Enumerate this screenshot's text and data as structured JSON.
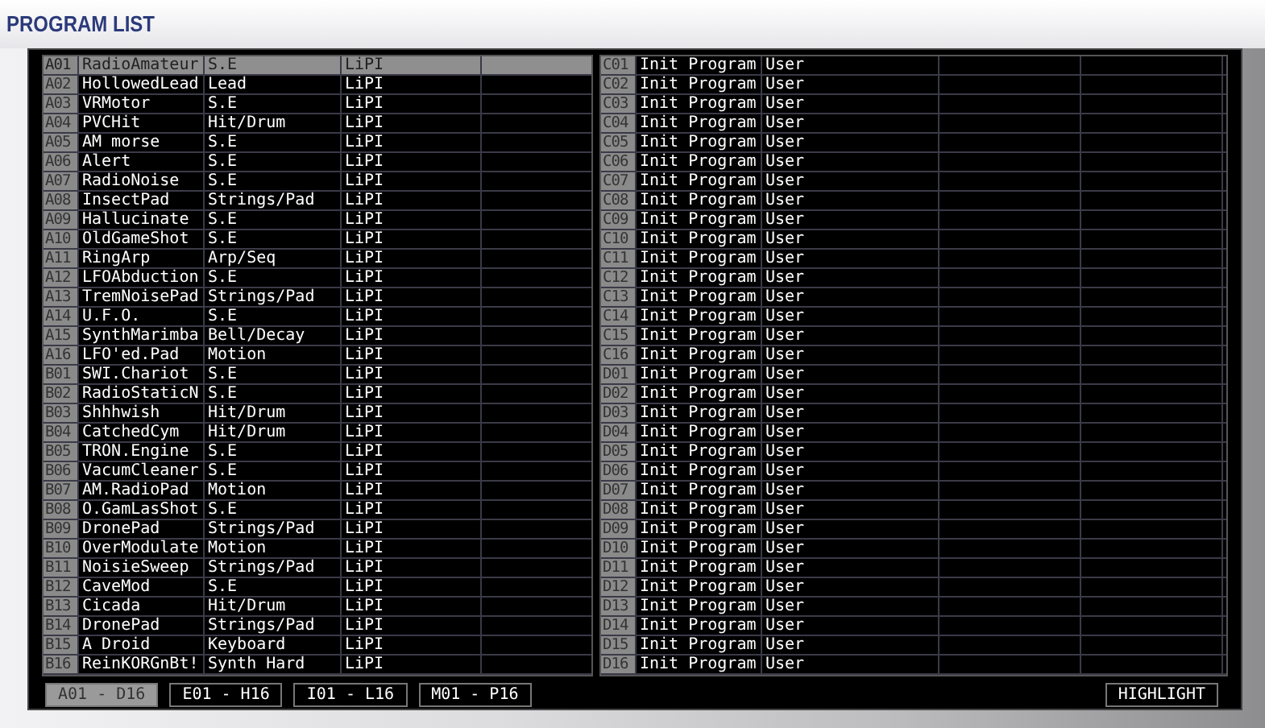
{
  "title": "PROGRAM LIST",
  "tables": [
    {
      "kind": "left",
      "rows": [
        {
          "id": "A01",
          "name": "RadioAmateur",
          "category": "S.E",
          "bank": "LiPI",
          "selected": true
        },
        {
          "id": "A02",
          "name": "HollowedLead",
          "category": "Lead",
          "bank": "LiPI",
          "selected": false
        },
        {
          "id": "A03",
          "name": "VRMotor",
          "category": "S.E",
          "bank": "LiPI",
          "selected": false
        },
        {
          "id": "A04",
          "name": "PVCHit",
          "category": "Hit/Drum",
          "bank": "LiPI",
          "selected": false
        },
        {
          "id": "A05",
          "name": "AM morse",
          "category": "S.E",
          "bank": "LiPI",
          "selected": false
        },
        {
          "id": "A06",
          "name": "Alert",
          "category": "S.E",
          "bank": "LiPI",
          "selected": false
        },
        {
          "id": "A07",
          "name": "RadioNoise",
          "category": "S.E",
          "bank": "LiPI",
          "selected": false
        },
        {
          "id": "A08",
          "name": "InsectPad",
          "category": "Strings/Pad",
          "bank": "LiPI",
          "selected": false
        },
        {
          "id": "A09",
          "name": "Hallucinate",
          "category": "S.E",
          "bank": "LiPI",
          "selected": false
        },
        {
          "id": "A10",
          "name": "OldGameShot",
          "category": "S.E",
          "bank": "LiPI",
          "selected": false
        },
        {
          "id": "A11",
          "name": "RingArp",
          "category": "Arp/Seq",
          "bank": "LiPI",
          "selected": false
        },
        {
          "id": "A12",
          "name": "LFOAbduction",
          "category": "S.E",
          "bank": "LiPI",
          "selected": false
        },
        {
          "id": "A13",
          "name": "TremNoisePad",
          "category": "Strings/Pad",
          "bank": "LiPI",
          "selected": false
        },
        {
          "id": "A14",
          "name": "U.F.O.",
          "category": "S.E",
          "bank": "LiPI",
          "selected": false
        },
        {
          "id": "A15",
          "name": "SynthMarimba",
          "category": "Bell/Decay",
          "bank": "LiPI",
          "selected": false
        },
        {
          "id": "A16",
          "name": "LFO'ed.Pad",
          "category": "Motion",
          "bank": "LiPI",
          "selected": false
        },
        {
          "id": "B01",
          "name": "SWI.Chariot",
          "category": "S.E",
          "bank": "LiPI",
          "selected": false
        },
        {
          "id": "B02",
          "name": "RadioStaticN",
          "category": "S.E",
          "bank": "LiPI",
          "selected": false
        },
        {
          "id": "B03",
          "name": "Shhhwish",
          "category": "Hit/Drum",
          "bank": "LiPI",
          "selected": false
        },
        {
          "id": "B04",
          "name": "CatchedCym",
          "category": "Hit/Drum",
          "bank": "LiPI",
          "selected": false
        },
        {
          "id": "B05",
          "name": "TRON.Engine",
          "category": "S.E",
          "bank": "LiPI",
          "selected": false
        },
        {
          "id": "B06",
          "name": "VacumCleaner",
          "category": "S.E",
          "bank": "LiPI",
          "selected": false
        },
        {
          "id": "B07",
          "name": "AM.RadioPad",
          "category": "Motion",
          "bank": "LiPI",
          "selected": false
        },
        {
          "id": "B08",
          "name": "O.GamLasShot",
          "category": "S.E",
          "bank": "LiPI",
          "selected": false
        },
        {
          "id": "B09",
          "name": "DronePad",
          "category": "Strings/Pad",
          "bank": "LiPI",
          "selected": false
        },
        {
          "id": "B10",
          "name": "OverModulate",
          "category": "Motion",
          "bank": "LiPI",
          "selected": false
        },
        {
          "id": "B11",
          "name": "NoisieSweep",
          "category": "Strings/Pad",
          "bank": "LiPI",
          "selected": false
        },
        {
          "id": "B12",
          "name": "CaveMod",
          "category": "S.E",
          "bank": "LiPI",
          "selected": false
        },
        {
          "id": "B13",
          "name": "Cicada",
          "category": "Hit/Drum",
          "bank": "LiPI",
          "selected": false
        },
        {
          "id": "B14",
          "name": "DronePad",
          "category": "Strings/Pad",
          "bank": "LiPI",
          "selected": false
        },
        {
          "id": "B15",
          "name": "A Droid",
          "category": "Keyboard",
          "bank": "LiPI",
          "selected": false
        },
        {
          "id": "B16",
          "name": "ReinKORGnBt!",
          "category": "Synth Hard",
          "bank": "LiPI",
          "selected": false
        }
      ]
    },
    {
      "kind": "right",
      "rows": [
        {
          "id": "C01",
          "name": "Init Program",
          "bank": "User",
          "selected": false
        },
        {
          "id": "C02",
          "name": "Init Program",
          "bank": "User",
          "selected": false
        },
        {
          "id": "C03",
          "name": "Init Program",
          "bank": "User",
          "selected": false
        },
        {
          "id": "C04",
          "name": "Init Program",
          "bank": "User",
          "selected": false
        },
        {
          "id": "C05",
          "name": "Init Program",
          "bank": "User",
          "selected": false
        },
        {
          "id": "C06",
          "name": "Init Program",
          "bank": "User",
          "selected": false
        },
        {
          "id": "C07",
          "name": "Init Program",
          "bank": "User",
          "selected": false
        },
        {
          "id": "C08",
          "name": "Init Program",
          "bank": "User",
          "selected": false
        },
        {
          "id": "C09",
          "name": "Init Program",
          "bank": "User",
          "selected": false
        },
        {
          "id": "C10",
          "name": "Init Program",
          "bank": "User",
          "selected": false
        },
        {
          "id": "C11",
          "name": "Init Program",
          "bank": "User",
          "selected": false
        },
        {
          "id": "C12",
          "name": "Init Program",
          "bank": "User",
          "selected": false
        },
        {
          "id": "C13",
          "name": "Init Program",
          "bank": "User",
          "selected": false
        },
        {
          "id": "C14",
          "name": "Init Program",
          "bank": "User",
          "selected": false
        },
        {
          "id": "C15",
          "name": "Init Program",
          "bank": "User",
          "selected": false
        },
        {
          "id": "C16",
          "name": "Init Program",
          "bank": "User",
          "selected": false
        },
        {
          "id": "D01",
          "name": "Init Program",
          "bank": "User",
          "selected": false
        },
        {
          "id": "D02",
          "name": "Init Program",
          "bank": "User",
          "selected": false
        },
        {
          "id": "D03",
          "name": "Init Program",
          "bank": "User",
          "selected": false
        },
        {
          "id": "D04",
          "name": "Init Program",
          "bank": "User",
          "selected": false
        },
        {
          "id": "D05",
          "name": "Init Program",
          "bank": "User",
          "selected": false
        },
        {
          "id": "D06",
          "name": "Init Program",
          "bank": "User",
          "selected": false
        },
        {
          "id": "D07",
          "name": "Init Program",
          "bank": "User",
          "selected": false
        },
        {
          "id": "D08",
          "name": "Init Program",
          "bank": "User",
          "selected": false
        },
        {
          "id": "D09",
          "name": "Init Program",
          "bank": "User",
          "selected": false
        },
        {
          "id": "D10",
          "name": "Init Program",
          "bank": "User",
          "selected": false
        },
        {
          "id": "D11",
          "name": "Init Program",
          "bank": "User",
          "selected": false
        },
        {
          "id": "D12",
          "name": "Init Program",
          "bank": "User",
          "selected": false
        },
        {
          "id": "D13",
          "name": "Init Program",
          "bank": "User",
          "selected": false
        },
        {
          "id": "D14",
          "name": "Init Program",
          "bank": "User",
          "selected": false
        },
        {
          "id": "D15",
          "name": "Init Program",
          "bank": "User",
          "selected": false
        },
        {
          "id": "D16",
          "name": "Init Program",
          "bank": "User",
          "selected": false
        }
      ]
    }
  ],
  "bank_tabs": [
    {
      "label": "A01 - D16",
      "selected": true
    },
    {
      "label": "E01 - H16",
      "selected": false
    },
    {
      "label": "I01 - L16",
      "selected": false
    },
    {
      "label": "M01 - P16",
      "selected": false
    }
  ],
  "highlight_button": "HIGHLIGHT"
}
